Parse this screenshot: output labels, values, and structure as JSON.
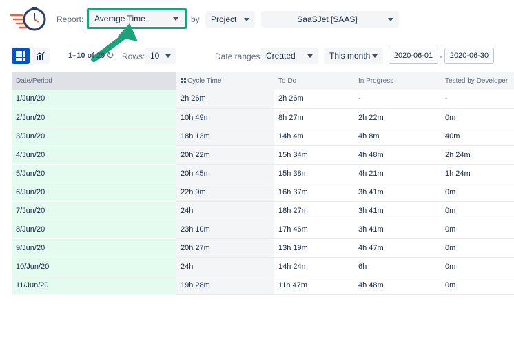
{
  "header": {
    "report_label": "Report:",
    "report_value": "Average Time",
    "by_label": "by",
    "group_value": "Project",
    "project_value": "SaaSJet [SAAS]"
  },
  "toolbar": {
    "paging": "1–10 of 29",
    "rows_label": "Rows:",
    "rows_value": "10",
    "date_ranges_label": "Date ranges:",
    "date_field_value": "Created",
    "period_value": "This month",
    "date_from": "2020-06-01",
    "date_separator": "-",
    "date_to": "2020-06-30"
  },
  "colors": {
    "accent": "#0052cc",
    "highlight": "#1aa37a",
    "date_column_bg": "#e3fcef"
  },
  "table": {
    "headers": [
      "Date/Period",
      "Cycle Time",
      "To Do",
      "In Progress",
      "Tested by Developer"
    ],
    "rows": [
      [
        "1/Jun/20",
        "2h 26m",
        "2h 26m",
        "-",
        "-"
      ],
      [
        "2/Jun/20",
        "10h 49m",
        "8h 27m",
        "2h 22m",
        "0m"
      ],
      [
        "3/Jun/20",
        "18h 13m",
        "14h 4m",
        "4h 8m",
        "40m"
      ],
      [
        "4/Jun/20",
        "20h 22m",
        "15h 34m",
        "4h 48m",
        "2h 24m"
      ],
      [
        "5/Jun/20",
        "20h 45m",
        "15h 38m",
        "4h 21m",
        "1h 24m"
      ],
      [
        "6/Jun/20",
        "22h 9m",
        "16h 37m",
        "3h 41m",
        "0m"
      ],
      [
        "7/Jun/20",
        "24h",
        "18h 27m",
        "3h 41m",
        "0m"
      ],
      [
        "8/Jun/20",
        "23h 10m",
        "17h 46m",
        "3h 41m",
        "0m"
      ],
      [
        "9/Jun/20",
        "20h 27m",
        "13h 19m",
        "4h 47m",
        "0m"
      ],
      [
        "10/Jun/20",
        "24h",
        "14h 24m",
        "6h",
        "0m"
      ],
      [
        "11/Jun/20",
        "19h 28m",
        "11h 47m",
        "4h 48m",
        "0m"
      ]
    ]
  }
}
